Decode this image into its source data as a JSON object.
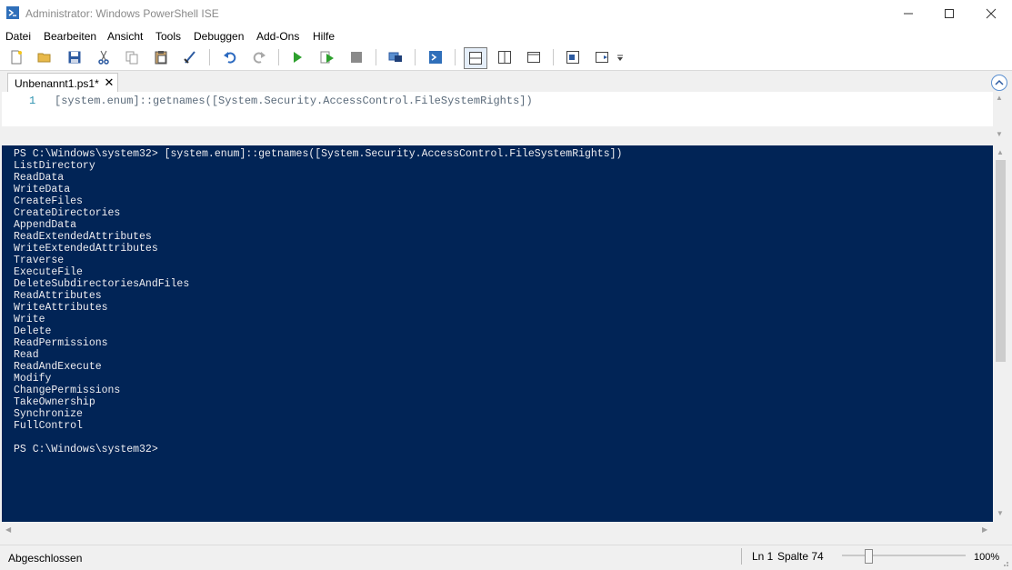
{
  "window": {
    "title": "Administrator: Windows PowerShell ISE",
    "app_icon": "powershell-ise-icon",
    "controls": [
      "minimize-icon",
      "maximize-icon",
      "close-icon"
    ]
  },
  "menu": {
    "items": [
      "Datei",
      "Bearbeiten",
      "Ansicht",
      "Tools",
      "Debuggen",
      "Add-Ons",
      "Hilfe"
    ]
  },
  "toolbar": {
    "icons": [
      "new-file-icon",
      "open-folder-icon",
      "save-icon",
      "cut-icon",
      "copy-icon",
      "paste-icon",
      "clear-console-icon",
      "undo-icon",
      "redo-icon",
      "run-script-icon",
      "run-selection-icon",
      "stop-icon",
      "remote-powershell-icon",
      "powershell-console-icon",
      "show-script-top-icon",
      "show-script-right-icon",
      "show-script-maximized-icon",
      "show-command-window-icon",
      "show-command-addon-icon",
      "overflow-chevron-icon"
    ]
  },
  "tabs": [
    {
      "label": "Unbenannt1.ps1*",
      "active": true
    }
  ],
  "editor": {
    "line_number": "1",
    "code": "[system.enum]::getnames([System.Security.AccessControl.FileSystemRights])"
  },
  "console": {
    "output": "PS C:\\Windows\\system32> [system.enum]::getnames([System.Security.AccessControl.FileSystemRights])\nListDirectory\nReadData\nWriteData\nCreateFiles\nCreateDirectories\nAppendData\nReadExtendedAttributes\nWriteExtendedAttributes\nTraverse\nExecuteFile\nDeleteSubdirectoriesAndFiles\nReadAttributes\nWriteAttributes\nWrite\nDelete\nReadPermissions\nRead\nReadAndExecute\nModify\nChangePermissions\nTakeOwnership\nSynchronize\nFullControl\n\nPS C:\\Windows\\system32>",
    "background": "#012456",
    "foreground": "#eeedf0"
  },
  "status": {
    "text": "Abgeschlossen",
    "line": "Ln 1",
    "column": "Spalte 74",
    "zoom": "100%",
    "zoom_slider_level": 0.2
  }
}
